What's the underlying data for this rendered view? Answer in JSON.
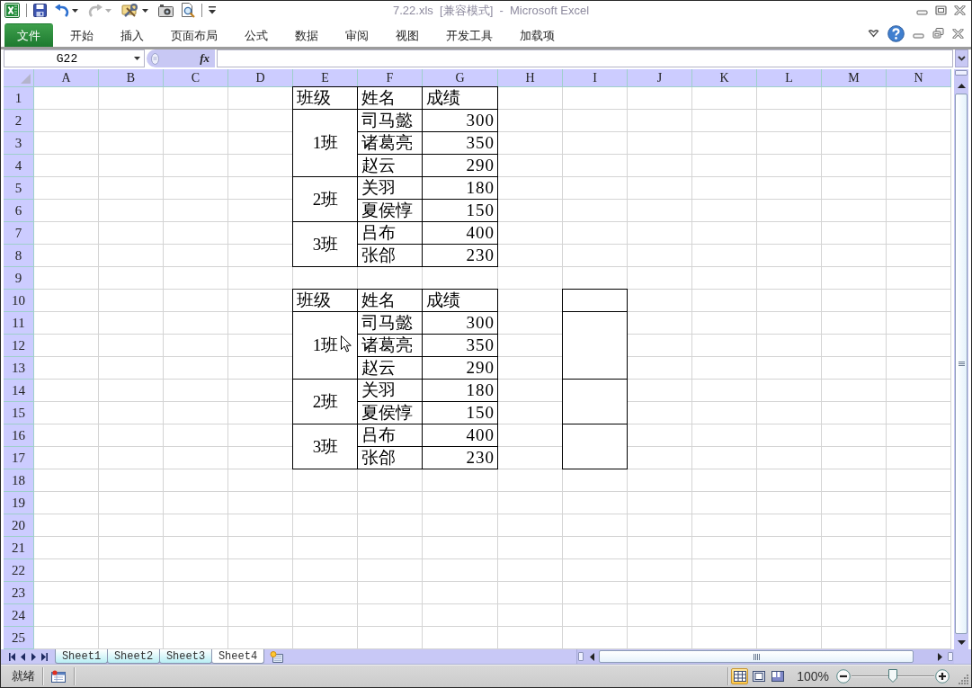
{
  "window": {
    "title": "7.22.xls  [兼容模式]  -  Microsoft Excel"
  },
  "ribbon_tabs": [
    {
      "label": "文件",
      "kind": "file",
      "selected": false
    },
    {
      "label": "开始",
      "kind": "tab",
      "selected": false
    },
    {
      "label": "插入",
      "kind": "tab",
      "selected": false
    },
    {
      "label": "页面布局",
      "kind": "tab",
      "selected": false
    },
    {
      "label": "公式",
      "kind": "tab",
      "selected": false
    },
    {
      "label": "数据",
      "kind": "tab",
      "selected": false
    },
    {
      "label": "审阅",
      "kind": "tab",
      "selected": false
    },
    {
      "label": "视图",
      "kind": "tab",
      "selected": false
    },
    {
      "label": "开发工具",
      "kind": "tab",
      "selected": false
    },
    {
      "label": "加载项",
      "kind": "tab",
      "selected": false
    }
  ],
  "formula_bar": {
    "name_box": "G22",
    "function_button": "fx"
  },
  "columns": [
    "A",
    "B",
    "C",
    "D",
    "E",
    "F",
    "G",
    "H",
    "I",
    "J",
    "K",
    "L",
    "M",
    "N"
  ],
  "rows": [
    "1",
    "2",
    "3",
    "4",
    "5",
    "6",
    "7",
    "8",
    "9",
    "10",
    "11",
    "12",
    "13",
    "14",
    "15",
    "16",
    "17",
    "18",
    "19",
    "20",
    "21",
    "22",
    "23",
    "24",
    "25"
  ],
  "tables": [
    {
      "header": [
        "班级",
        "姓名",
        "成绩"
      ],
      "helper_column": false,
      "groups": [
        {
          "class": "1班",
          "students": [
            {
              "name": "司马懿",
              "score": "300"
            },
            {
              "name": "诸葛亮",
              "score": "350"
            },
            {
              "name": "赵云",
              "score": "290"
            }
          ]
        },
        {
          "class": "2班",
          "students": [
            {
              "name": "关羽",
              "score": "180"
            },
            {
              "name": "夏侯惇",
              "score": "150"
            }
          ]
        },
        {
          "class": "3班",
          "students": [
            {
              "name": "吕布",
              "score": "400"
            },
            {
              "name": "张郃",
              "score": "230"
            }
          ]
        }
      ]
    },
    {
      "header": [
        "班级",
        "姓名",
        "成绩"
      ],
      "helper_column": true,
      "groups": [
        {
          "class": "1班",
          "students": [
            {
              "name": "司马懿",
              "score": "300"
            },
            {
              "name": "诸葛亮",
              "score": "350"
            },
            {
              "name": "赵云",
              "score": "290"
            }
          ]
        },
        {
          "class": "2班",
          "students": [
            {
              "name": "关羽",
              "score": "180"
            },
            {
              "name": "夏侯惇",
              "score": "150"
            }
          ]
        },
        {
          "class": "3班",
          "students": [
            {
              "name": "吕布",
              "score": "400"
            },
            {
              "name": "张郃",
              "score": "230"
            }
          ]
        }
      ]
    }
  ],
  "sheet_tabs": [
    {
      "label": "Sheet1",
      "selected": false
    },
    {
      "label": "Sheet2",
      "selected": false
    },
    {
      "label": "Sheet3",
      "selected": false
    },
    {
      "label": "Sheet4",
      "selected": true
    }
  ],
  "status_bar": {
    "text": "就绪",
    "views": [
      {
        "kind": "normal",
        "selected": true
      },
      {
        "kind": "page_layout",
        "selected": false
      },
      {
        "kind": "page_break",
        "selected": false
      }
    ],
    "zoom": {
      "reading": "100%",
      "level": 0.5
    }
  }
}
